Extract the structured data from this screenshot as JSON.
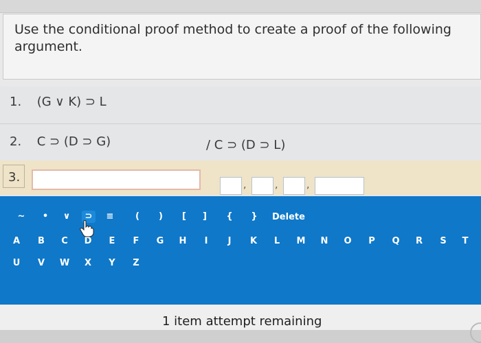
{
  "instruction": "Use the conditional proof method to create a proof of the following argument.",
  "premises": [
    {
      "number": "1.",
      "formula": "(G ∨ K) ⊃ L"
    },
    {
      "number": "2.",
      "formula": "C ⊃ (D ⊃ G)"
    }
  ],
  "conclusion": "/ C ⊃ (D ⊃ L)",
  "active_line": {
    "number": "3.",
    "formula_value": "",
    "justification_values": [
      "",
      "",
      "",
      ""
    ]
  },
  "justification_separator": ",",
  "keyboard": {
    "symbol_keys": [
      "~",
      "•",
      "∨",
      "⊃",
      "≡",
      "(",
      ")",
      "[",
      "]",
      "{",
      "}"
    ],
    "delete_label": "Delete",
    "letter_rows": [
      [
        "A",
        "B",
        "C",
        "D",
        "E",
        "F",
        "G",
        "H",
        "I",
        "J",
        "K",
        "L",
        "M",
        "N",
        "O",
        "P",
        "Q",
        "R",
        "S",
        "T"
      ],
      [
        "U",
        "V",
        "W",
        "X",
        "Y",
        "Z"
      ]
    ]
  },
  "footer": {
    "attempts_text": "1 item attempt remaining"
  },
  "colors": {
    "keyboard_bg": "#0f78c9",
    "active_row_bg": "#efe3c8",
    "input_border": "#e4b9a8"
  }
}
